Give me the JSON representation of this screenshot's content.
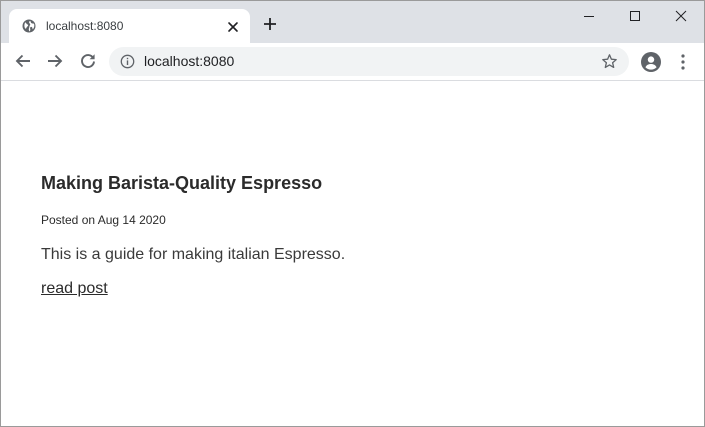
{
  "browser": {
    "tab": {
      "title": "localhost:8080",
      "favicon": "globe-icon",
      "close_icon": "close-icon"
    },
    "new_tab_icon": "plus-icon",
    "window_controls": [
      "minimize-icon",
      "maximize-icon",
      "close-icon"
    ],
    "toolbar": {
      "back_icon": "arrow-left-icon",
      "forward_icon": "arrow-right-icon",
      "reload_icon": "reload-icon",
      "site_info_icon": "info-icon",
      "url": "localhost:8080",
      "bookmark_icon": "star-icon",
      "profile_icon": "account-icon",
      "menu_icon": "more-vert-icon"
    },
    "colors": {
      "tabstrip_bg": "#dee1e6",
      "omnibox_bg": "#f1f3f4",
      "icon": "#5f6368"
    }
  },
  "page": {
    "post": {
      "title": "Making Barista-Quality Espresso",
      "date_line": "Posted on Aug 14 2020",
      "description": "This is a guide for making italian Espresso.",
      "link_label": "read post"
    }
  }
}
